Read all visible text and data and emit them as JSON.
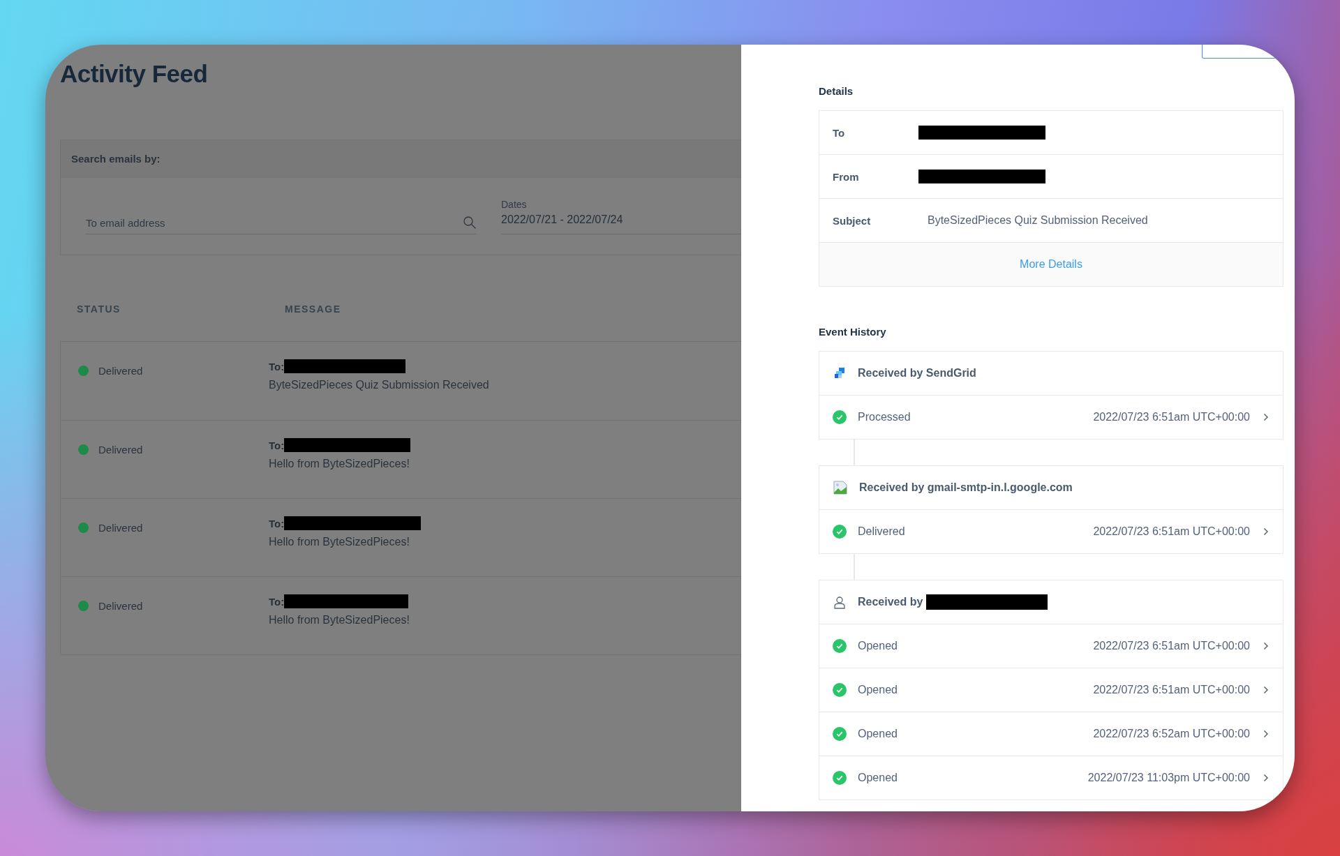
{
  "page": {
    "title": "Activity Feed"
  },
  "search": {
    "heading": "Search emails by:",
    "placeholder": "To email address",
    "dates_label": "Dates",
    "dates_value": "2022/07/21 - 2022/07/24"
  },
  "table": {
    "columns": [
      "STATUS",
      "MESSAGE"
    ],
    "rows": [
      {
        "status": "Delivered",
        "color": "#1c8a48",
        "to_label": "To:",
        "subject": "ByteSizedPieces Quiz Submission Received"
      },
      {
        "status": "Delivered",
        "color": "#1c8a48",
        "to_label": "To:",
        "subject": "Hello from ByteSizedPieces!"
      },
      {
        "status": "Delivered",
        "color": "#1c8a48",
        "to_label": "To:",
        "subject": "Hello from ByteSizedPieces!"
      },
      {
        "status": "Delivered",
        "color": "#1c8a48",
        "to_label": "To:",
        "subject": "Hello from ByteSizedPieces!"
      }
    ]
  },
  "details": {
    "heading": "Details",
    "rows": [
      {
        "label": "To",
        "redacted": true
      },
      {
        "label": "From",
        "redacted": true
      },
      {
        "label": "Subject",
        "redacted": false,
        "value": "ByteSizedPieces Quiz Submission Received"
      }
    ],
    "link": "More Details"
  },
  "event_history": {
    "heading": "Event History",
    "groups": [
      {
        "kind": "sendgrid",
        "title": "Received by SendGrid",
        "redacted": false,
        "events": [
          {
            "name": "Processed",
            "time": "2022/07/23 6:51am UTC+00:00"
          }
        ]
      },
      {
        "kind": "image",
        "title": "Received by gmail-smtp-in.l.google.com",
        "redacted": false,
        "events": [
          {
            "name": "Delivered",
            "time": "2022/07/23 6:51am UTC+00:00"
          }
        ]
      },
      {
        "kind": "person",
        "title": "Received by",
        "redacted": true,
        "events": [
          {
            "name": "Opened",
            "time": "2022/07/23 6:51am UTC+00:00"
          },
          {
            "name": "Opened",
            "time": "2022/07/23 6:51am UTC+00:00"
          },
          {
            "name": "Opened",
            "time": "2022/07/23 6:52am UTC+00:00"
          },
          {
            "name": "Opened",
            "time": "2022/07/23 11:03pm UTC+00:00"
          }
        ]
      }
    ]
  }
}
